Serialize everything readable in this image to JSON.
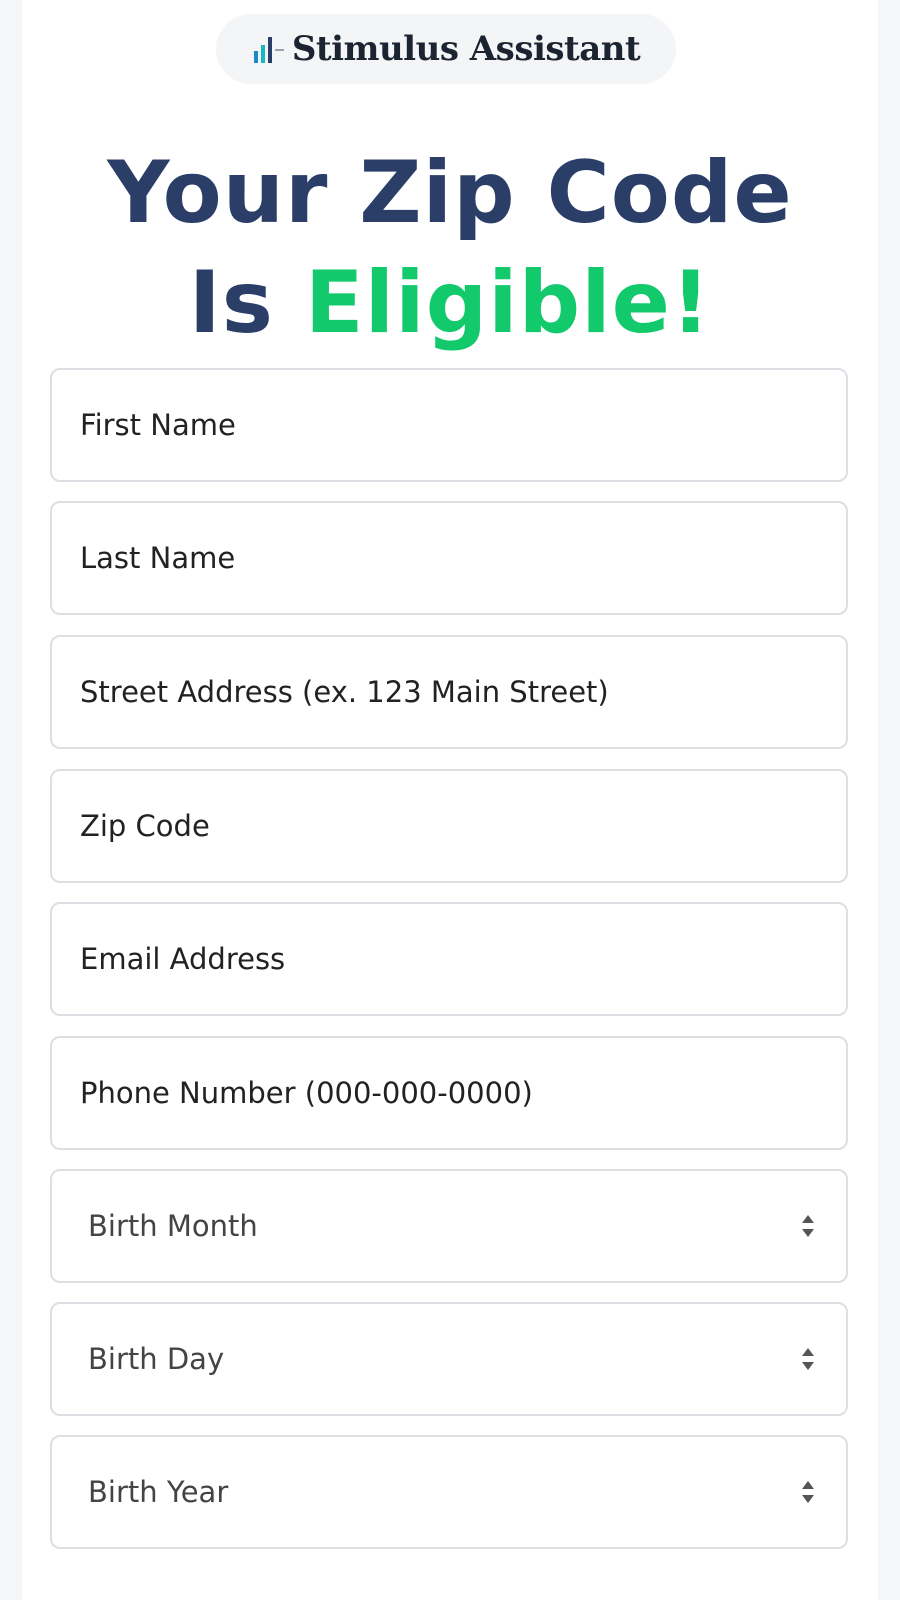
{
  "brand": {
    "name": "Stimulus Assistant",
    "icon": "bar-chart-icon",
    "colors": [
      "#1e88c9",
      "#17b8c4",
      "#2b3e68"
    ]
  },
  "headline": {
    "line1": "Your Zip Code",
    "line2_part1": "Is",
    "line2_part2": "Eligible!",
    "color_primary": "#2b3e68",
    "color_accent": "#12c96c"
  },
  "form": {
    "first_name": {
      "placeholder": "First Name",
      "value": ""
    },
    "last_name": {
      "placeholder": "Last Name",
      "value": ""
    },
    "street_address": {
      "placeholder": "Street Address (ex. 123 Main Street)",
      "value": ""
    },
    "zip_code": {
      "placeholder": "Zip Code",
      "value": ""
    },
    "email": {
      "placeholder": "Email Address",
      "value": ""
    },
    "phone": {
      "placeholder": "Phone Number (000-000-0000)",
      "value": ""
    },
    "birth_month": {
      "selected": "Birth Month",
      "icon": "sort-arrows-icon"
    },
    "birth_day": {
      "selected": "Birth Day",
      "icon": "sort-arrows-icon"
    },
    "birth_year": {
      "selected": "Birth Year",
      "icon": "sort-arrows-icon"
    }
  }
}
